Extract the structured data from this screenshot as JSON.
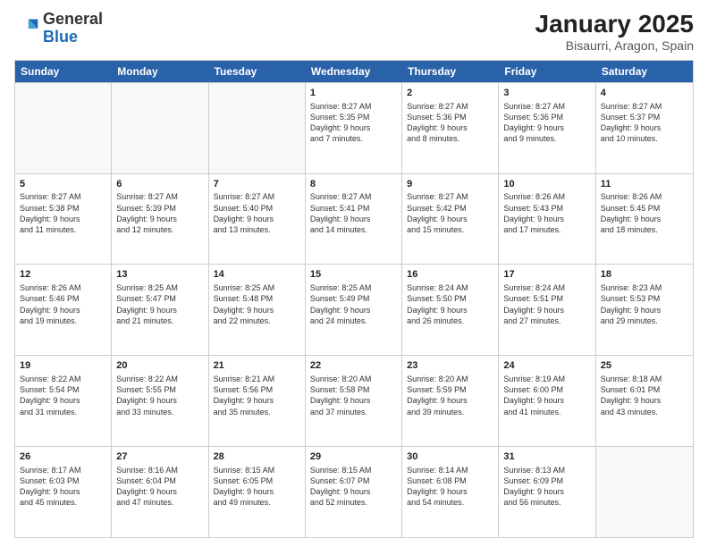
{
  "header": {
    "logo_general": "General",
    "logo_blue": "Blue",
    "month": "January 2025",
    "location": "Bisaurri, Aragon, Spain"
  },
  "days_of_week": [
    "Sunday",
    "Monday",
    "Tuesday",
    "Wednesday",
    "Thursday",
    "Friday",
    "Saturday"
  ],
  "weeks": [
    [
      {
        "day": "",
        "info": ""
      },
      {
        "day": "",
        "info": ""
      },
      {
        "day": "",
        "info": ""
      },
      {
        "day": "1",
        "info": "Sunrise: 8:27 AM\nSunset: 5:35 PM\nDaylight: 9 hours\nand 7 minutes."
      },
      {
        "day": "2",
        "info": "Sunrise: 8:27 AM\nSunset: 5:36 PM\nDaylight: 9 hours\nand 8 minutes."
      },
      {
        "day": "3",
        "info": "Sunrise: 8:27 AM\nSunset: 5:36 PM\nDaylight: 9 hours\nand 9 minutes."
      },
      {
        "day": "4",
        "info": "Sunrise: 8:27 AM\nSunset: 5:37 PM\nDaylight: 9 hours\nand 10 minutes."
      }
    ],
    [
      {
        "day": "5",
        "info": "Sunrise: 8:27 AM\nSunset: 5:38 PM\nDaylight: 9 hours\nand 11 minutes."
      },
      {
        "day": "6",
        "info": "Sunrise: 8:27 AM\nSunset: 5:39 PM\nDaylight: 9 hours\nand 12 minutes."
      },
      {
        "day": "7",
        "info": "Sunrise: 8:27 AM\nSunset: 5:40 PM\nDaylight: 9 hours\nand 13 minutes."
      },
      {
        "day": "8",
        "info": "Sunrise: 8:27 AM\nSunset: 5:41 PM\nDaylight: 9 hours\nand 14 minutes."
      },
      {
        "day": "9",
        "info": "Sunrise: 8:27 AM\nSunset: 5:42 PM\nDaylight: 9 hours\nand 15 minutes."
      },
      {
        "day": "10",
        "info": "Sunrise: 8:26 AM\nSunset: 5:43 PM\nDaylight: 9 hours\nand 17 minutes."
      },
      {
        "day": "11",
        "info": "Sunrise: 8:26 AM\nSunset: 5:45 PM\nDaylight: 9 hours\nand 18 minutes."
      }
    ],
    [
      {
        "day": "12",
        "info": "Sunrise: 8:26 AM\nSunset: 5:46 PM\nDaylight: 9 hours\nand 19 minutes."
      },
      {
        "day": "13",
        "info": "Sunrise: 8:25 AM\nSunset: 5:47 PM\nDaylight: 9 hours\nand 21 minutes."
      },
      {
        "day": "14",
        "info": "Sunrise: 8:25 AM\nSunset: 5:48 PM\nDaylight: 9 hours\nand 22 minutes."
      },
      {
        "day": "15",
        "info": "Sunrise: 8:25 AM\nSunset: 5:49 PM\nDaylight: 9 hours\nand 24 minutes."
      },
      {
        "day": "16",
        "info": "Sunrise: 8:24 AM\nSunset: 5:50 PM\nDaylight: 9 hours\nand 26 minutes."
      },
      {
        "day": "17",
        "info": "Sunrise: 8:24 AM\nSunset: 5:51 PM\nDaylight: 9 hours\nand 27 minutes."
      },
      {
        "day": "18",
        "info": "Sunrise: 8:23 AM\nSunset: 5:53 PM\nDaylight: 9 hours\nand 29 minutes."
      }
    ],
    [
      {
        "day": "19",
        "info": "Sunrise: 8:22 AM\nSunset: 5:54 PM\nDaylight: 9 hours\nand 31 minutes."
      },
      {
        "day": "20",
        "info": "Sunrise: 8:22 AM\nSunset: 5:55 PM\nDaylight: 9 hours\nand 33 minutes."
      },
      {
        "day": "21",
        "info": "Sunrise: 8:21 AM\nSunset: 5:56 PM\nDaylight: 9 hours\nand 35 minutes."
      },
      {
        "day": "22",
        "info": "Sunrise: 8:20 AM\nSunset: 5:58 PM\nDaylight: 9 hours\nand 37 minutes."
      },
      {
        "day": "23",
        "info": "Sunrise: 8:20 AM\nSunset: 5:59 PM\nDaylight: 9 hours\nand 39 minutes."
      },
      {
        "day": "24",
        "info": "Sunrise: 8:19 AM\nSunset: 6:00 PM\nDaylight: 9 hours\nand 41 minutes."
      },
      {
        "day": "25",
        "info": "Sunrise: 8:18 AM\nSunset: 6:01 PM\nDaylight: 9 hours\nand 43 minutes."
      }
    ],
    [
      {
        "day": "26",
        "info": "Sunrise: 8:17 AM\nSunset: 6:03 PM\nDaylight: 9 hours\nand 45 minutes."
      },
      {
        "day": "27",
        "info": "Sunrise: 8:16 AM\nSunset: 6:04 PM\nDaylight: 9 hours\nand 47 minutes."
      },
      {
        "day": "28",
        "info": "Sunrise: 8:15 AM\nSunset: 6:05 PM\nDaylight: 9 hours\nand 49 minutes."
      },
      {
        "day": "29",
        "info": "Sunrise: 8:15 AM\nSunset: 6:07 PM\nDaylight: 9 hours\nand 52 minutes."
      },
      {
        "day": "30",
        "info": "Sunrise: 8:14 AM\nSunset: 6:08 PM\nDaylight: 9 hours\nand 54 minutes."
      },
      {
        "day": "31",
        "info": "Sunrise: 8:13 AM\nSunset: 6:09 PM\nDaylight: 9 hours\nand 56 minutes."
      },
      {
        "day": "",
        "info": ""
      }
    ]
  ]
}
